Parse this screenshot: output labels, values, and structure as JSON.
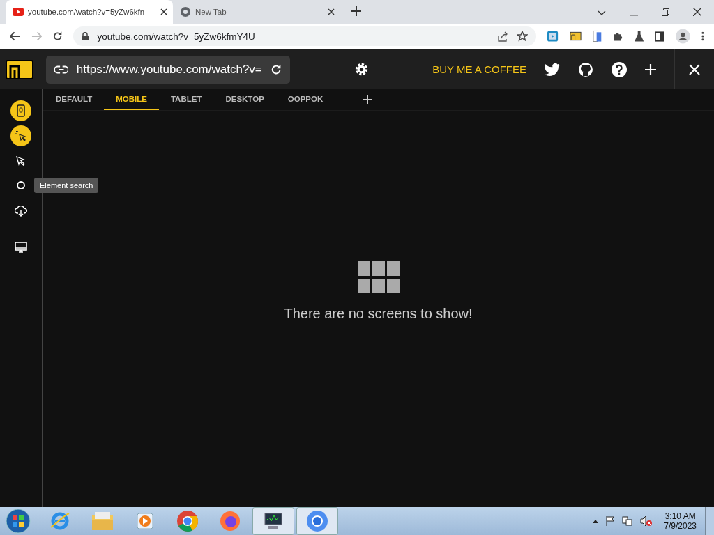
{
  "browser": {
    "tabs": [
      {
        "title": "youtube.com/watch?v=5yZw6kfn",
        "selected": true,
        "kind": "video"
      },
      {
        "title": "New Tab",
        "selected": false,
        "kind": "chrome"
      }
    ],
    "address": "youtube.com/watch?v=5yZw6kfmY4U"
  },
  "app": {
    "url": "https://www.youtube.com/watch?v=",
    "buy_coffee": "BUY ME A COFFEE",
    "view_tabs": [
      {
        "label": "DEFAULT",
        "selected": false
      },
      {
        "label": "MOBILE",
        "selected": true
      },
      {
        "label": "TABLET",
        "selected": false
      },
      {
        "label": "DESKTOP",
        "selected": false
      },
      {
        "label": "OOPPOK",
        "selected": false
      }
    ],
    "tools": [
      {
        "kind": "device",
        "highlighted": true
      },
      {
        "kind": "click",
        "highlighted": true
      },
      {
        "kind": "pointer",
        "highlighted": false
      },
      {
        "kind": "search",
        "highlighted": false,
        "tooltip": "Element search"
      },
      {
        "kind": "download",
        "highlighted": false
      },
      {
        "kind": "monitor",
        "highlighted": false
      }
    ],
    "empty_message": "There are no screens to show!"
  },
  "taskbar": {
    "apps": [
      {
        "kind": "ie",
        "running": false
      },
      {
        "kind": "explorer",
        "running": false
      },
      {
        "kind": "media",
        "running": false
      },
      {
        "kind": "chrome",
        "running": false
      },
      {
        "kind": "firefox",
        "running": false
      },
      {
        "kind": "monitor",
        "running": true
      },
      {
        "kind": "chromium",
        "running": true
      }
    ],
    "time": "3:10 AM",
    "date": "7/9/2023"
  }
}
